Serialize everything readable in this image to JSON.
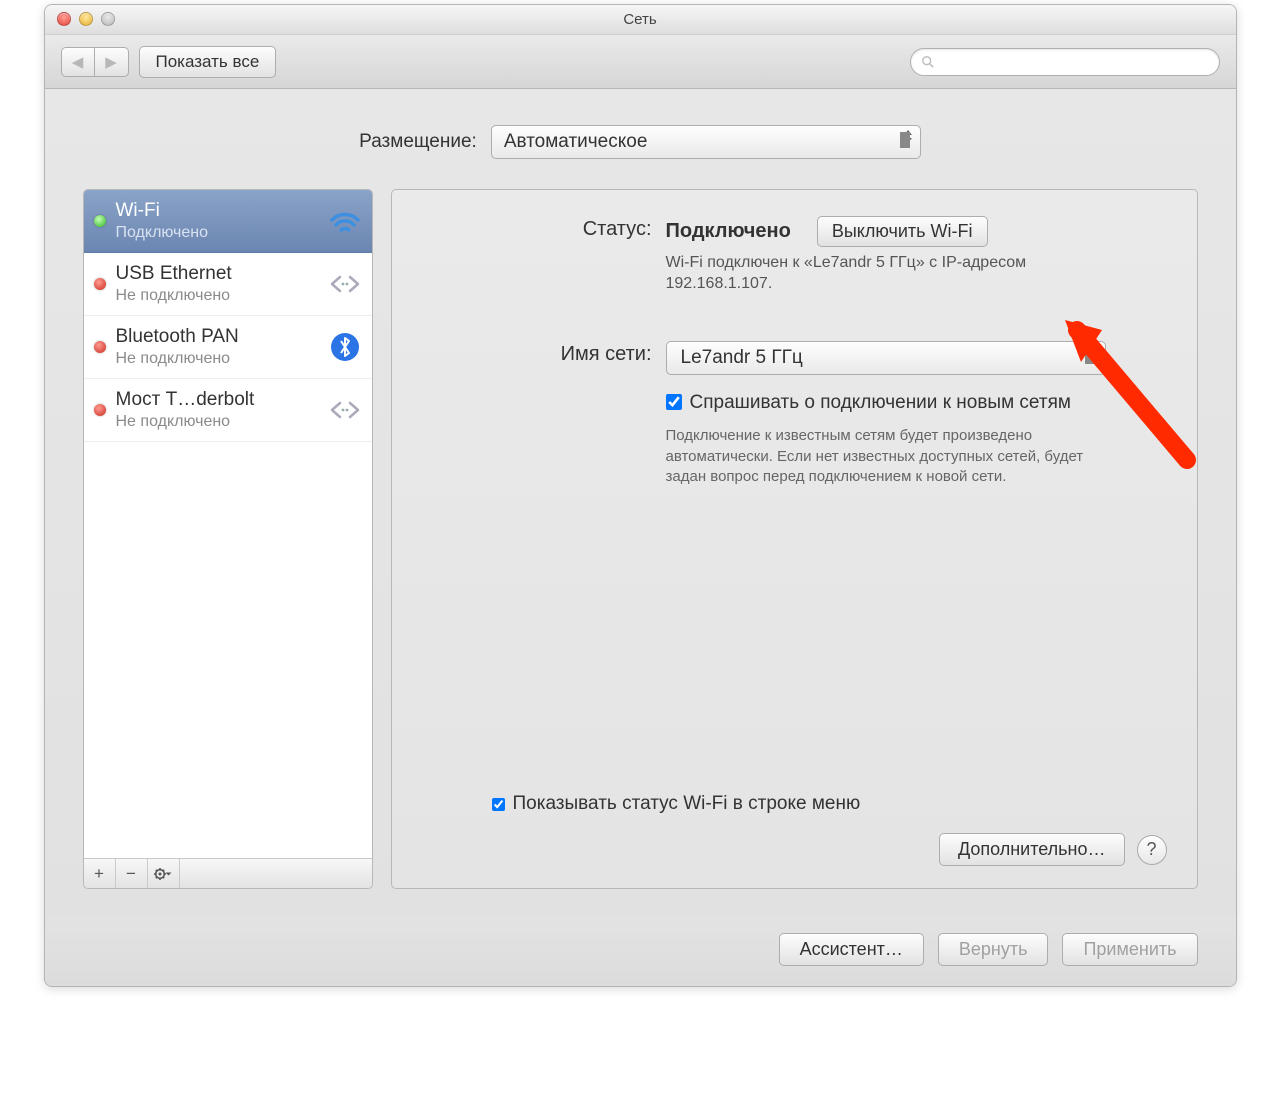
{
  "window": {
    "title": "Сеть"
  },
  "toolbar": {
    "show_all": "Показать все",
    "search_placeholder": ""
  },
  "location": {
    "label": "Размещение:",
    "value": "Автоматическое"
  },
  "services": [
    {
      "name": "Wi-Fi",
      "status": "Подключено",
      "dot": "green",
      "icon": "wifi",
      "selected": true
    },
    {
      "name": "USB Ethernet",
      "status": "Не подключено",
      "dot": "red",
      "icon": "ethernet",
      "selected": false
    },
    {
      "name": "Bluetooth PAN",
      "status": "Не подключено",
      "dot": "red",
      "icon": "bluetooth",
      "selected": false
    },
    {
      "name": "Мост T…derbolt",
      "status": "Не подключено",
      "dot": "red",
      "icon": "ethernet",
      "selected": false
    }
  ],
  "detail": {
    "status_label": "Статус:",
    "status_value": "Подключено",
    "wifi_off_btn": "Выключить Wi-Fi",
    "status_desc": "Wi-Fi подключен к «Le7andr 5 ГГц» с IP-адресом 192.168.1.107.",
    "network_label": "Имя сети:",
    "network_value": "Le7andr 5 ГГц",
    "ask_join_label": "Спрашивать о подключении к новым сетям",
    "ask_join_help": "Подключение к известным сетям будет произведено автоматически. Если нет известных доступных сетей, будет задан вопрос перед подключением к новой сети.",
    "show_in_menubar": "Показывать статус Wi-Fi в строке меню",
    "advanced_btn": "Дополнительно…"
  },
  "footer": {
    "assistant": "Ассистент…",
    "revert": "Вернуть",
    "apply": "Применить"
  }
}
